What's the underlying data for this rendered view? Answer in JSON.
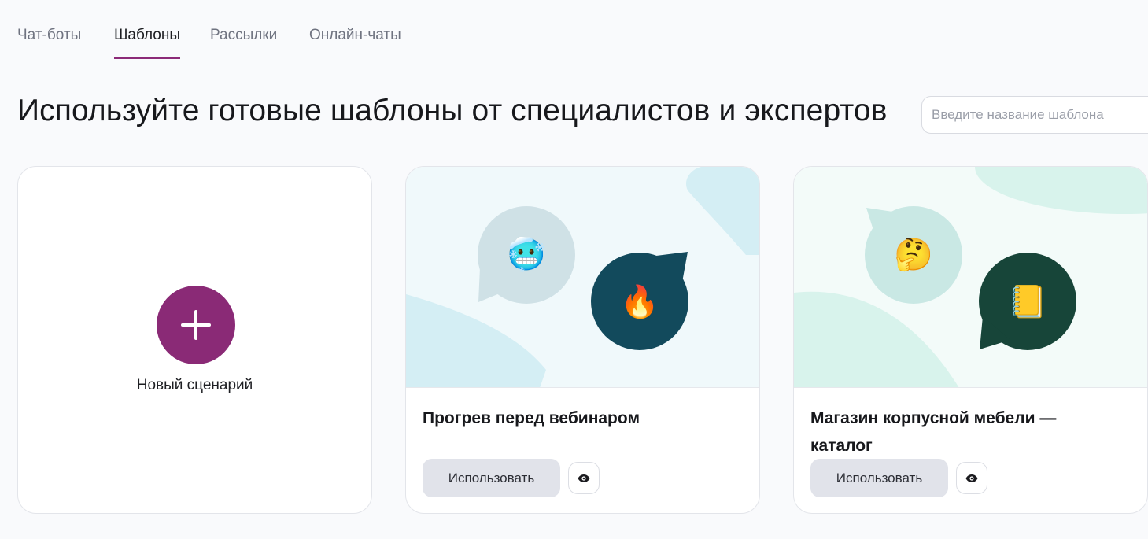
{
  "tabs": [
    {
      "label": "Чат-боты",
      "active": false
    },
    {
      "label": "Шаблоны",
      "active": true
    },
    {
      "label": "Рассылки",
      "active": false
    },
    {
      "label": "Онлайн-чаты",
      "active": false
    }
  ],
  "headline": "Используйте готовые шаблоны от специалистов и экспертов",
  "search": {
    "placeholder": "Введите название шаблона",
    "value": ""
  },
  "new_card": {
    "label": "Новый сценарий",
    "icon": "plus-icon"
  },
  "templates": [
    {
      "title": "Прогрев перед вебинаром",
      "use_label": "Использовать",
      "preview_icon": "eye-icon",
      "emojis": [
        "🥶",
        "🔥"
      ],
      "colors": {
        "bg": "#f0f9fb",
        "bubble_light": "#cfe1e6",
        "bubble_dark": "#124a5c"
      }
    },
    {
      "title": "Магазин корпусной мебели — каталог",
      "use_label": "Использовать",
      "preview_icon": "eye-icon",
      "emojis": [
        "🤔",
        "📒"
      ],
      "colors": {
        "bg": "#f0faf7",
        "bubble_light": "#c9e8e4",
        "bubble_dark": "#174539"
      }
    }
  ],
  "colors": {
    "accent": "#8a2a76",
    "page_bg": "#f9fafc"
  }
}
